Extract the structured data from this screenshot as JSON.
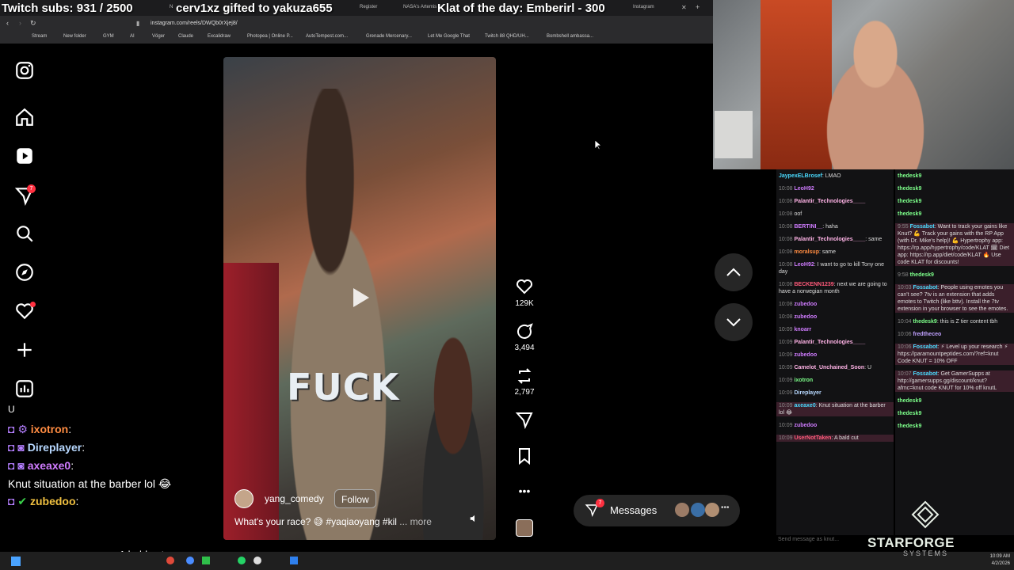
{
  "overlay": {
    "subs": "Twitch subs: 931 / 2500",
    "gift": "cerv1xz gifted to yakuza655",
    "klat": "Klat of the day: Emberirl - 300"
  },
  "browser": {
    "tabs": [
      "N",
      "Register",
      "NASA's Artemis II",
      "",
      "Instagram"
    ],
    "url": "instagram.com/reels/DWQb0rXjej8/",
    "bookmarks": [
      "Stream",
      "New folder",
      "GYM",
      "AI",
      "Vöger",
      "Claude",
      "Excalidraw",
      "Photopea | Online P...",
      "AutoTempest.com...",
      "Grenade Mercenary...",
      "Let Me Google That",
      "Twitch 88 QHD/UH...",
      "Bombshell ambassa..."
    ]
  },
  "sidebar": {
    "notif_badge": "7",
    "items": [
      "instagram-icon",
      "home-icon",
      "reels-icon",
      "direct-icon",
      "search-icon",
      "explore-icon",
      "notifications-icon",
      "create-icon",
      "dashboard-icon"
    ]
  },
  "reel": {
    "overlay_text": "FUCK",
    "author": "yang_comedy",
    "follow_label": "Follow",
    "caption": "What's your race? 😅 #yaqiaoyang #kil",
    "caption_more": "... more"
  },
  "actions": {
    "likes": "129K",
    "comments": "3,494",
    "reposts": "2,797"
  },
  "messages": {
    "label": "Messages",
    "badge": "7"
  },
  "left_chat": [
    {
      "text": "U"
    },
    {
      "name": "ixotron",
      "sep": ":"
    },
    {
      "name": "Direplayer",
      "sep": ":"
    },
    {
      "name": "axeaxe0",
      "sep": ":"
    },
    {
      "text": "Knut situation at the barber lol 😂"
    },
    {
      "name": "zubedoo",
      "sep": ":"
    },
    {
      "text": "A bald cut"
    }
  ],
  "chat1": [
    {
      "ts": "",
      "user": "JaypexELBrosef",
      "msg": "LMAO"
    },
    {
      "ts": "10:08",
      "user": "LeoH92",
      "msg": ""
    },
    {
      "ts": "10:08",
      "user": "Palantir_Technologies____",
      "msg": ""
    },
    {
      "ts": "10:08",
      "user": "",
      "msg": "oof"
    },
    {
      "ts": "10:08",
      "user": "BERTINI__",
      "msg": "haha"
    },
    {
      "ts": "10:08",
      "user": "Palantir_Technologies____",
      "msg": "same"
    },
    {
      "ts": "10:08",
      "user": "moralsup",
      "msg": "same"
    },
    {
      "ts": "10:08",
      "user": "LeoH92",
      "msg": "I want to go to kill Tony one day"
    },
    {
      "ts": "10:08",
      "user": "BECKENN1239",
      "msg": "next we are going to have a norwegian month"
    },
    {
      "ts": "10:08",
      "user": "zubedoo",
      "msg": ""
    },
    {
      "ts": "10:08",
      "user": "zubedoo",
      "msg": ""
    },
    {
      "ts": "10:09",
      "user": "knoarr",
      "msg": ""
    },
    {
      "ts": "10:09",
      "user": "Palantir_Technologies____",
      "msg": ""
    },
    {
      "ts": "10:09",
      "user": "zubedoo",
      "msg": ""
    },
    {
      "ts": "10:09",
      "user": "Camelot_Unchained_Soon",
      "msg": "U"
    },
    {
      "ts": "10:09",
      "user": "ixotron",
      "msg": ""
    },
    {
      "ts": "10:09",
      "user": "Direplayer",
      "msg": ""
    },
    {
      "ts": "10:09",
      "user": "axeaxe0",
      "msg": "Knut situation at the barber lol 😂"
    },
    {
      "ts": "10:09",
      "user": "zubedoo",
      "msg": ""
    },
    {
      "ts": "10:09",
      "user": "UserNotTaken",
      "msg": "A bald cut"
    }
  ],
  "chat2": [
    {
      "ts": "",
      "user": "thedesk9",
      "msg": ""
    },
    {
      "ts": "",
      "user": "thedesk9",
      "msg": ""
    },
    {
      "ts": "",
      "user": "thedesk9",
      "msg": ""
    },
    {
      "ts": "",
      "user": "thedesk9",
      "msg": ""
    },
    {
      "ts": "9:55",
      "user": "Fossabot",
      "msg": "Want to track your gains like Knut? 💪 Track your gains with the RP App (with Dr. Mike's help)! 💪 Hypertrophy app: https://rp.app/hypertrophy/code/KLAT 🗓 Diet app: https://rp.app/diet/code/KLAT 🔥 Use code KLAT for discounts!"
    },
    {
      "ts": "9:58",
      "user": "thedesk9",
      "msg": ""
    },
    {
      "ts": "10:03",
      "user": "Fossabot",
      "msg": "People using emotes you can't see? 7tv is an extension that adds emotes to Twitch (like bttv). Install the 7tv extension in your browser to see the emotes."
    },
    {
      "ts": "10:04",
      "user": "thedesk9",
      "msg": "this is Z tier content tbh"
    },
    {
      "ts": "10:06",
      "user": "fredtheceo",
      "msg": ""
    },
    {
      "ts": "10:06",
      "user": "Fossabot",
      "msg": "⚡ Level up your research ⚡ https://paramountpeptides.com/?ref=knut Code KNUT = 10% OFF"
    },
    {
      "ts": "10:07",
      "user": "Fossabot",
      "msg": "Get GamerSupps at http://gamersupps.gg/discount/knut?afmc=knut code KNUT for 10% off knutL"
    },
    {
      "ts": "",
      "user": "thedesk9",
      "msg": ""
    },
    {
      "ts": "",
      "user": "thedesk9",
      "msg": ""
    },
    {
      "ts": "",
      "user": "thedesk9",
      "msg": ""
    }
  ],
  "chat_input_placeholder": "Send message as knut...",
  "branding": {
    "name": "STARFORGE",
    "sub": "SYSTEMS"
  },
  "clock": {
    "time": "10:09 AM",
    "date": "4/2/2026"
  },
  "colors": {
    "badge": "#ff3040",
    "link": "#4a9eff",
    "accent": "#ff4b4b"
  }
}
